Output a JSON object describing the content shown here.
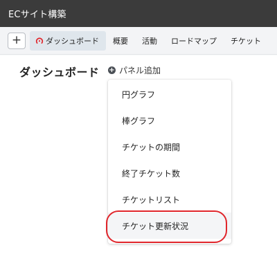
{
  "app": {
    "title": "ECサイト構築"
  },
  "tabbar": {
    "add_label": "+",
    "tabs": [
      {
        "label": "ダッシュボード",
        "active": true,
        "icon": "dashboard-icon"
      },
      {
        "label": "概要"
      },
      {
        "label": "活動"
      },
      {
        "label": "ロードマップ"
      },
      {
        "label": "チケット"
      }
    ]
  },
  "main": {
    "title": "ダッシュボード",
    "add_panel": {
      "icon": "plus-circle-icon",
      "label": "パネル追加"
    }
  },
  "menu": {
    "items": [
      {
        "label": "円グラフ"
      },
      {
        "label": "棒グラフ"
      },
      {
        "label": "チケットの期間"
      },
      {
        "label": "終了チケット数"
      },
      {
        "label": "チケットリスト"
      },
      {
        "label": "チケット更新状況",
        "highlighted": true
      }
    ]
  },
  "colors": {
    "topbar": "#3b3b3b",
    "active_tab": "#dfe6ec",
    "dashboard_icon": "#e0252b",
    "annotation": "#e0252b"
  }
}
